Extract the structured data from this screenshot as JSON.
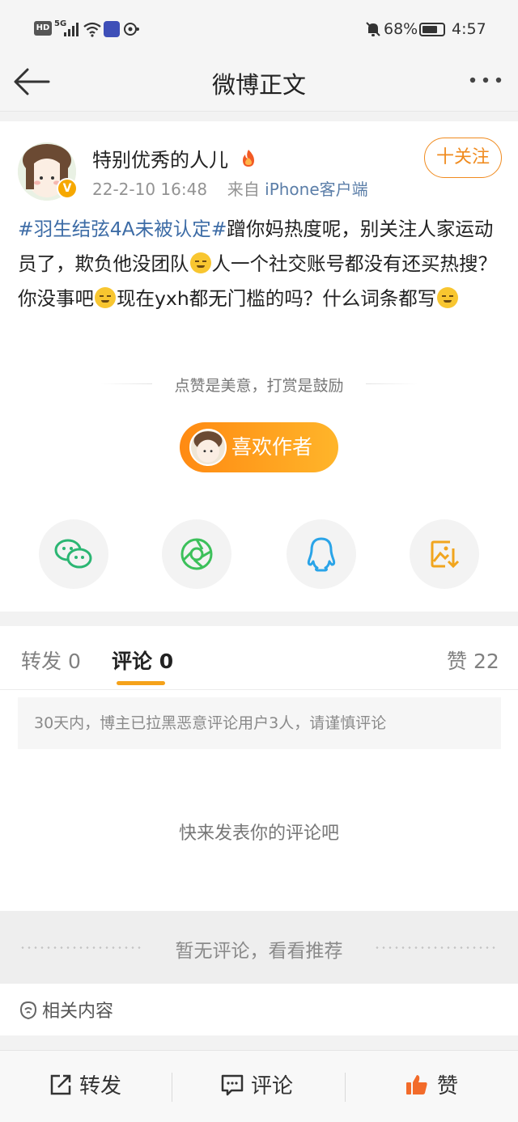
{
  "status_bar": {
    "hd": "HD",
    "network": "5G",
    "battery": "68%",
    "time": "4:57"
  },
  "nav": {
    "title": "微博正文"
  },
  "post": {
    "username": "特别优秀的人儿",
    "date": "22-2-10 16:48",
    "source_prefix": "来自",
    "source": "iPhone客户端",
    "follow_label": "十关注",
    "hashtag": "#羽生结弦4A未被认定#",
    "text_1": "蹭你妈热度呢，别关注人家运动员了，欺负他没团队",
    "text_2": "人一个社交账号都没有还买热搜？你没事吧",
    "text_3": "现在yxh都无门槛的吗？什么词条都写"
  },
  "reward": {
    "tagline": "点赞是美意，打赏是鼓励",
    "button_label": "喜欢作者"
  },
  "share": {
    "icons": [
      "wechat-icon",
      "moments-icon",
      "qq-icon",
      "save-image-icon"
    ]
  },
  "tabs": {
    "repost_label": "转发",
    "repost_count": "0",
    "comment_label": "评论",
    "comment_count": "0",
    "like_label": "赞",
    "like_count": "22"
  },
  "comments": {
    "notice": "30天内，博主已拉黑恶意评论用户3人，请谨慎评论",
    "empty_tip": "快来发表你的评论吧"
  },
  "recommend": {
    "text": "暂无评论，看看推荐"
  },
  "related": {
    "label": "相关内容"
  },
  "toolbar": {
    "repost": "转发",
    "comment": "评论",
    "like": "赞"
  },
  "colors": {
    "accent_orange": "#f08b1f",
    "hashtag_blue": "#3d6ca6",
    "like_icon": "#f26b2a"
  }
}
